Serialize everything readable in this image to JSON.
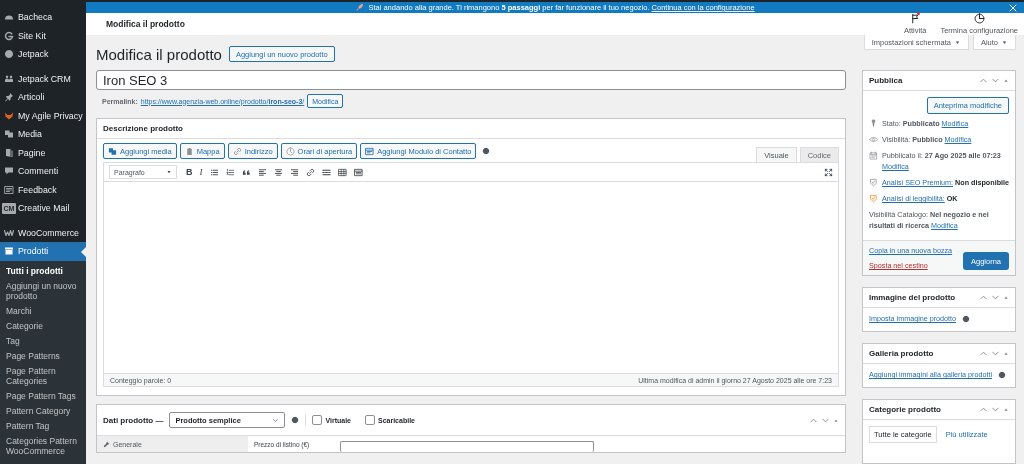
{
  "sidebar": {
    "groups": [
      [
        {
          "label": "Bacheca",
          "selected": false
        },
        {
          "label": "Site Kit",
          "selected": false
        },
        {
          "label": "Jetpack",
          "selected": false
        }
      ],
      [
        {
          "label": "Jetpack CRM",
          "selected": false
        },
        {
          "label": "Articoli",
          "selected": false
        },
        {
          "label": "My Agile Privacy",
          "selected": false
        },
        {
          "label": "Media",
          "selected": false
        },
        {
          "label": "Pagine",
          "selected": false
        },
        {
          "label": "Commenti",
          "selected": false
        },
        {
          "label": "Feedback",
          "selected": false
        },
        {
          "label": "Creative Mail",
          "badge": "CM",
          "selected": false
        }
      ],
      [
        {
          "label": "WooCommerce",
          "selected": false
        },
        {
          "label": "Prodotti",
          "selected": true,
          "children": [
            {
              "label": "Tutti i prodotti",
              "selected": true
            },
            {
              "label": "Aggiungi un nuovo prodotto",
              "selected": false
            },
            {
              "label": "Marchi",
              "selected": false
            },
            {
              "label": "Categorie",
              "selected": false
            },
            {
              "label": "Tag",
              "selected": false
            },
            {
              "label": "Page Patterns",
              "selected": false
            },
            {
              "label": "Page Pattern Categories",
              "selected": false
            },
            {
              "label": "Page Pattern Tags",
              "selected": false
            },
            {
              "label": "Pattern Category",
              "selected": false
            },
            {
              "label": "Pattern Tag",
              "selected": false
            },
            {
              "label": "Categories Pattern WooCommerce",
              "selected": false
            }
          ]
        }
      ]
    ]
  },
  "notice": {
    "text": "Stai andando alla grande. Ti rimangono **5 passaggi** per far funzionare il tuo negozio.",
    "link": "Continua con la configurazione"
  },
  "header": {
    "title": "Modifica il prodotto",
    "actions": [
      {
        "label": "Attività",
        "unread": true
      },
      {
        "label": "Termina configurazione",
        "unread": false
      }
    ]
  },
  "screen_links": [
    "Impostazioni schermata",
    "Aiuto"
  ],
  "page": {
    "title": "Modifica il prodotto",
    "add_button": "Aggiungi un nuovo prodotto",
    "product_title": "Iron SEO 3",
    "permalink": {
      "label": "Permalink:",
      "url": "https://www.agenzia-web.online/prodotto/**iron-seo-3**/",
      "button": "Modifica"
    }
  },
  "description": {
    "title": "Descrizione prodotto",
    "media_buttons": [
      "Aggiungi media",
      "Mappa",
      "Indirizzo",
      "Orari di apertura",
      "Aggiungi Modulo di Contatto"
    ],
    "tabs": [
      {
        "label": "Visuale",
        "selected": true
      },
      {
        "label": "Codice",
        "selected": false
      }
    ],
    "format": "Paragrafo",
    "toolbar": [
      {
        "kind": "bold",
        "label": "B"
      },
      {
        "kind": "italic",
        "label": "I"
      },
      {
        "kind": "ul"
      },
      {
        "kind": "ol"
      },
      {
        "kind": "quote"
      },
      {
        "kind": "align-left"
      },
      {
        "kind": "align-center"
      },
      {
        "kind": "align-right"
      },
      {
        "kind": "link"
      },
      {
        "kind": "more"
      },
      {
        "kind": "toolbar"
      },
      {
        "kind": "table"
      }
    ],
    "word_count": "Conteggio parole: 0",
    "last_edit": "Ultima modifica di admin il giorno 27 Agosto 2025 alle ore 7:23"
  },
  "product_data": {
    "title": "Dati prodotto —",
    "type": "Prodotto semplice",
    "options": [
      {
        "label": "Virtuale",
        "checked": false
      },
      {
        "label": "Scaricabile",
        "checked": false
      }
    ],
    "tabs": [
      {
        "label": "Generale",
        "selected": true
      }
    ],
    "field": "Prezzo di listino (€)"
  },
  "publish": {
    "title": "Pubblica",
    "preview": "Anteprima modifiche",
    "rows": [
      {
        "kind": "meta",
        "text": "Stato: **Pubblicato**",
        "link": "Modifica"
      },
      {
        "kind": "meta",
        "text": "Visibilità: **Pubblico**",
        "link": "Modifica"
      },
      {
        "kind": "meta",
        "text": "Pubblicato il: **27 Ago 2025 alle 07:23**",
        "link": "Modifica"
      },
      {
        "kind": "analysis",
        "link": "Analisi SEO Premium:",
        "text": "Non disponibile"
      },
      {
        "kind": "analysis",
        "link": "Analisi di leggibilità:",
        "text": "OK"
      },
      {
        "kind": "meta",
        "text": "Visibilità Catalogo: **Nel negozio e nei risultati di ricerca**",
        "link": "Modifica"
      }
    ],
    "copy": "Copia in una nuova bozza",
    "trash": "Sposta nel cestino",
    "update": "Aggiorna"
  },
  "side_boxes": [
    {
      "title": "Immagine del prodotto",
      "kind": "link",
      "link": "Imposta immagine prodotto"
    },
    {
      "title": "Galleria prodotto",
      "kind": "link",
      "link": "Aggiungi immagini alla galleria prodotti"
    },
    {
      "title": "Categorie prodotto",
      "kind": "tabs",
      "tabs": [
        {
          "label": "Tutte le categorie",
          "selected": true
        },
        {
          "label": "Più utilizzate",
          "selected": false
        }
      ]
    }
  ]
}
